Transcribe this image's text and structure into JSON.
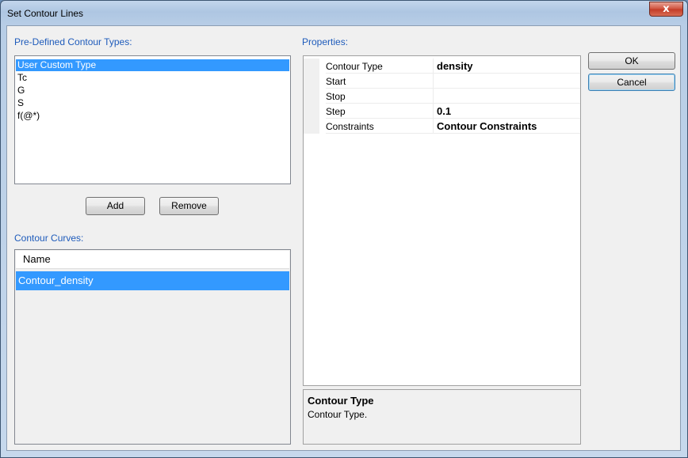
{
  "window": {
    "title": "Set Contour Lines",
    "close_glyph": "x"
  },
  "predefined": {
    "label": "Pre-Defined Contour Types:",
    "items": [
      {
        "label": "User Custom Type",
        "selected": true
      },
      {
        "label": "Tc",
        "selected": false
      },
      {
        "label": "G",
        "selected": false
      },
      {
        "label": "S",
        "selected": false
      },
      {
        "label": "f(@*)",
        "selected": false
      }
    ],
    "add_label": "Add",
    "remove_label": "Remove"
  },
  "curves": {
    "label": "Contour Curves:",
    "column_header": "Name",
    "items": [
      {
        "label": "Contour_density",
        "selected": true
      }
    ]
  },
  "properties": {
    "label": "Properties:",
    "rows": [
      {
        "name": "Contour Type",
        "value": "density"
      },
      {
        "name": "Start",
        "value": ""
      },
      {
        "name": "Stop",
        "value": ""
      },
      {
        "name": "Step",
        "value": "0.1"
      },
      {
        "name": "Constraints",
        "value": "Contour Constraints"
      }
    ],
    "help_title": "Contour Type",
    "help_description": "Contour Type."
  },
  "buttons": {
    "ok_label": "OK",
    "cancel_label": "Cancel"
  },
  "colors": {
    "accent_label": "#1e5bbb",
    "selection": "#3399ff"
  }
}
